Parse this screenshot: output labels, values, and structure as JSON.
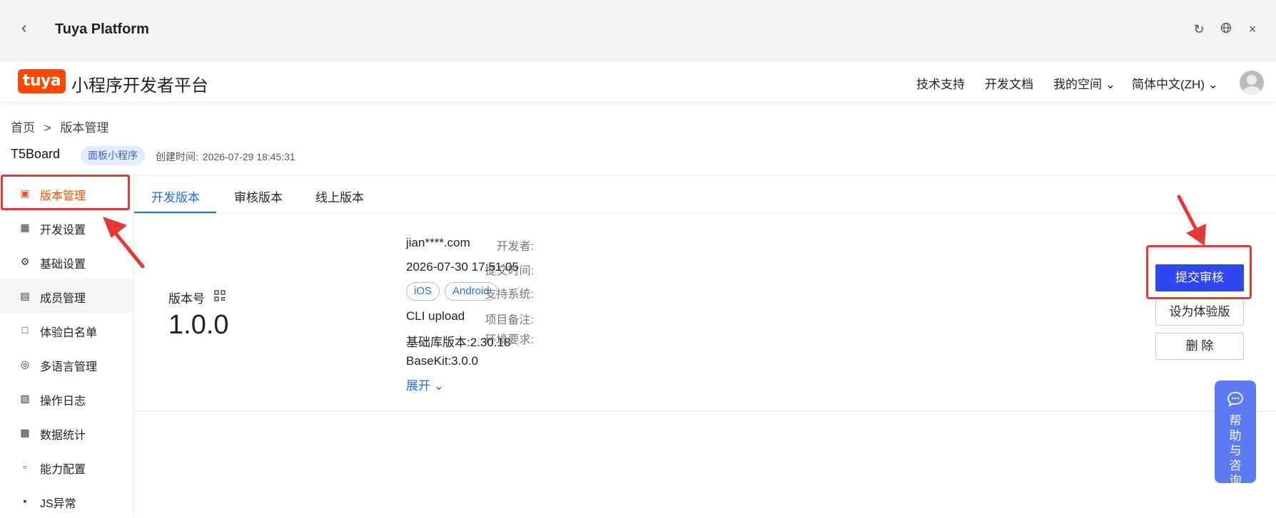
{
  "window": {
    "title": "Tuya Platform"
  },
  "header": {
    "logo_text": "tuya",
    "platform_name": "小程序开发者平台",
    "nav": [
      {
        "label": "技术支持"
      },
      {
        "label": "开发文档"
      },
      {
        "label": "我的空间"
      },
      {
        "label": "简体中文(ZH)"
      }
    ]
  },
  "breadcrumb": {
    "home": "首页",
    "separator": ">",
    "current": "版本管理"
  },
  "app": {
    "name": "T5Board",
    "tag": "面板小程序",
    "created_label": "创建时间:",
    "created_value": "2026-07-29 18:45:31"
  },
  "sidebar": {
    "items": [
      {
        "label": "版本管理",
        "icon": "folder-check-icon"
      },
      {
        "label": "开发设置",
        "icon": "terminal-icon"
      },
      {
        "label": "基础设置",
        "icon": "gear-icon"
      },
      {
        "label": "成员管理",
        "icon": "member-icon"
      },
      {
        "label": "体验白名单",
        "icon": "whitelist-icon"
      },
      {
        "label": "多语言管理",
        "icon": "globe-icon"
      },
      {
        "label": "操作日志",
        "icon": "log-icon"
      },
      {
        "label": "数据统计",
        "icon": "bar-chart-icon"
      },
      {
        "label": "能力配置",
        "icon": "config-icon"
      },
      {
        "label": "JS异常",
        "icon": "js-error-icon"
      }
    ]
  },
  "tabs": [
    {
      "label": "开发版本"
    },
    {
      "label": "审核版本"
    },
    {
      "label": "线上版本"
    }
  ],
  "version": {
    "label": "版本号",
    "number": "1.0.0",
    "developer_label": "开发者:",
    "developer": "jian****.com",
    "submit_time_label": "提交时间:",
    "submit_time": "2026-07-30 17:51:05",
    "systems_label": "支持系统:",
    "systems": [
      "iOS",
      "Android"
    ],
    "remark_label": "项目备注:",
    "remark": "CLI upload",
    "env_label": "环境要求:",
    "env_base": "基础库版本:2.30.18",
    "env_basekit": "BaseKit:3.0.0",
    "expand": "展开"
  },
  "actions": {
    "submit_review": "提交审核",
    "set_experience": "设为体验版",
    "delete": "删 除"
  },
  "help": {
    "label": "帮助与咨询"
  },
  "colors": {
    "accent": "#ff4d00",
    "primary": "#2e47f0",
    "link": "#1f6fd6",
    "annotation": "#e53935"
  }
}
